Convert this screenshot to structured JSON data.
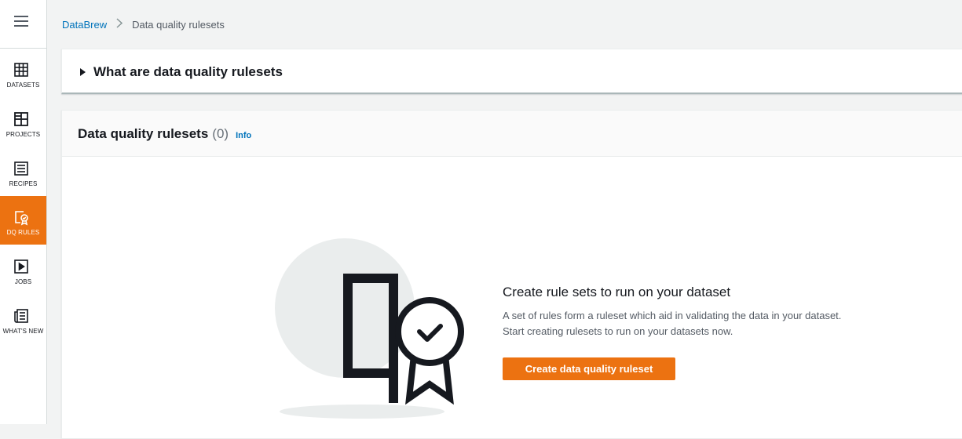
{
  "sidebar": {
    "items": [
      {
        "label": "DATASETS",
        "icon": "table-icon"
      },
      {
        "label": "PROJECTS",
        "icon": "grid-icon"
      },
      {
        "label": "RECIPES",
        "icon": "list-icon"
      },
      {
        "label": "DQ RULES",
        "icon": "rules-badge-icon",
        "active": true
      },
      {
        "label": "JOBS",
        "icon": "play-icon"
      },
      {
        "label": "WHAT'S NEW",
        "icon": "newspaper-icon"
      }
    ]
  },
  "breadcrumb": {
    "root": "DataBrew",
    "current": "Data quality rulesets"
  },
  "expander": {
    "label": "What are data quality rulesets"
  },
  "rulesets": {
    "title": "Data quality rulesets",
    "count": "(0)",
    "info": "Info"
  },
  "empty_state": {
    "title": "Create rule sets to run on your dataset",
    "description": "A set of rules form a ruleset which aid in validating the data in your dataset. Start creating rulesets to run on your datasets now.",
    "button": "Create data quality ruleset"
  },
  "colors": {
    "accent": "#ec7211",
    "link": "#0073bb"
  }
}
